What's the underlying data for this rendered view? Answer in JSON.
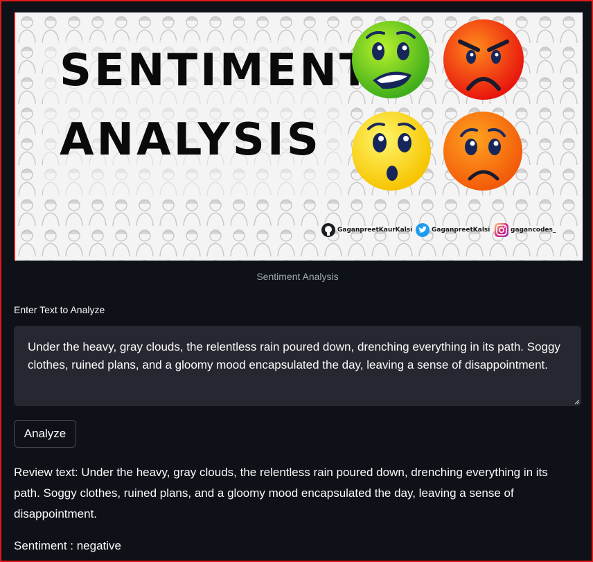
{
  "banner": {
    "title_line1": "SENTIMENT",
    "title_line2": "ANALYSIS",
    "social": [
      {
        "icon": "github-icon",
        "handle": "GaganpreetKaurKalsi"
      },
      {
        "icon": "twitter-icon",
        "handle": "GaganpreetKalsi"
      },
      {
        "icon": "instagram-icon",
        "handle": "gagancodes_"
      }
    ],
    "emojis": [
      "green-nervous-emoji-icon",
      "red-angry-emoji-icon",
      "yellow-surprised-emoji-icon",
      "orange-sad-emoji-icon"
    ]
  },
  "caption": "Sentiment Analysis",
  "input": {
    "label": "Enter Text to Analyze",
    "value": "Under the heavy, gray clouds, the relentless rain poured down, drenching everything in its path. Soggy clothes, ruined plans, and a gloomy mood encapsulated the day, leaving a sense of disappointment."
  },
  "analyze_button": "Analyze",
  "result": {
    "review_text": "Review text: Under the heavy, gray clouds, the relentless rain poured down, drenching everything in its path. Soggy clothes, ruined plans, and a gloomy mood encapsulated the day, leaving a sense of disappointment.",
    "sentiment": "Sentiment : negative"
  },
  "colors": {
    "background": "#0e1117",
    "input_bg": "#262730",
    "frame": "#e01b1b"
  }
}
